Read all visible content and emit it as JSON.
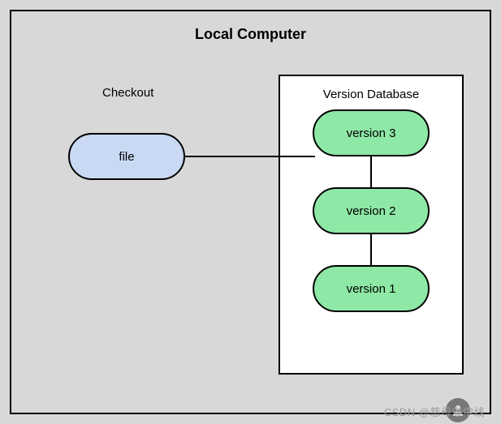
{
  "chart_data": {
    "type": "diagram",
    "container": "Local Computer",
    "checkout": {
      "label": "Checkout",
      "file": "file"
    },
    "version_database": {
      "label": "Version Database",
      "versions": [
        "version 3",
        "version 2",
        "version 1"
      ]
    },
    "edges": [
      {
        "from": "file",
        "to": "version 3"
      },
      {
        "from": "version 3",
        "to": "version 2"
      },
      {
        "from": "version 2",
        "to": "version 1"
      }
    ]
  },
  "title": "Local Computer",
  "checkout_label": "Checkout",
  "file_label": "file",
  "vdb_label": "Version Database",
  "versions": {
    "0": "version 3",
    "1": "version 2",
    "2": "version 1"
  },
  "watermark": "CSDN @慈母守中线"
}
